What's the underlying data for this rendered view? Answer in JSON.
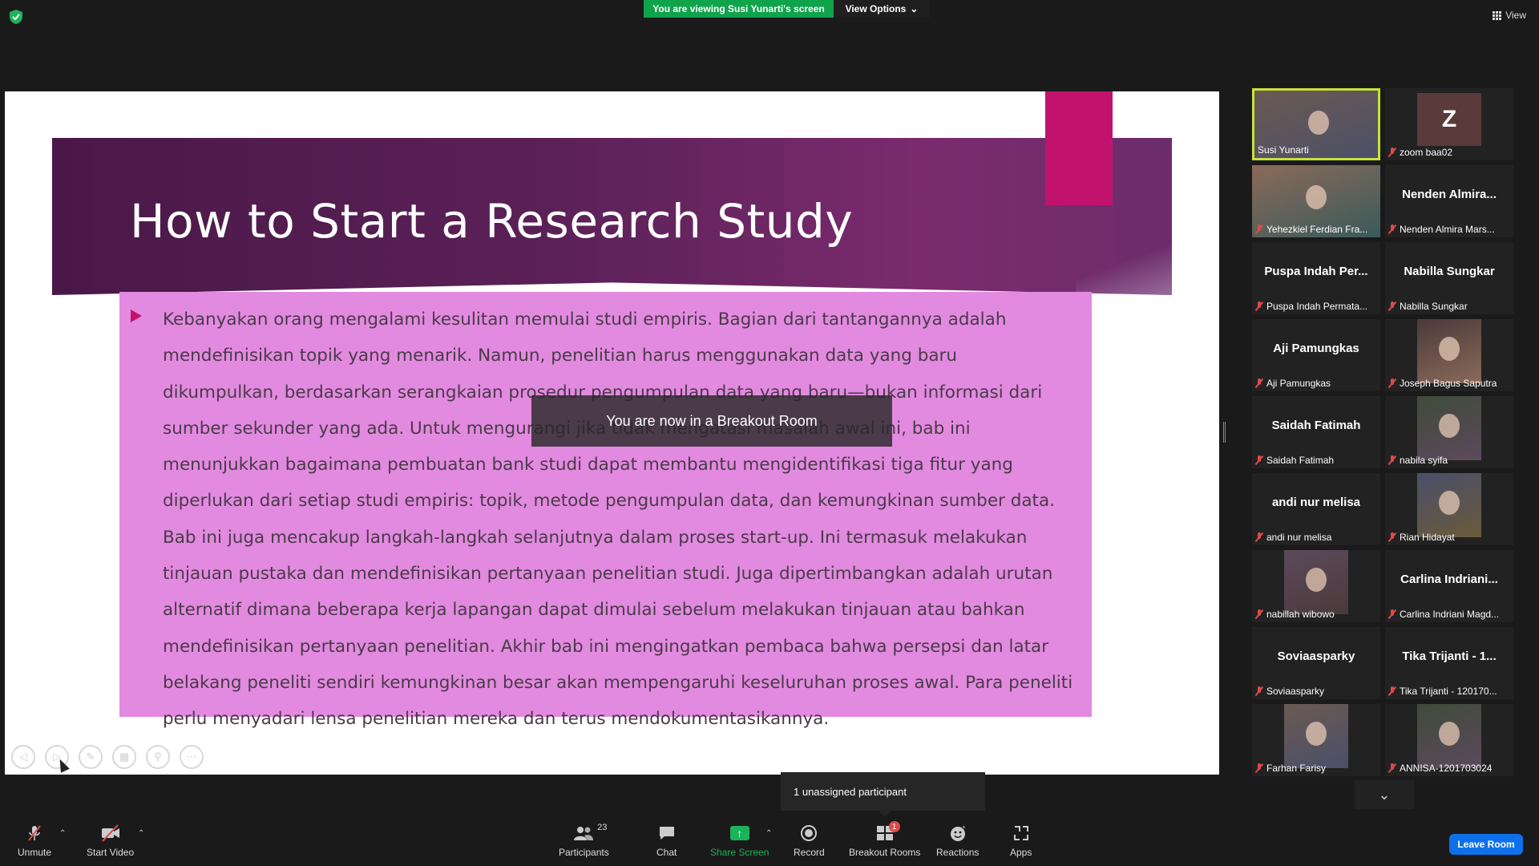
{
  "top": {
    "viewing_banner": "You are viewing Susi Yunarti's screen",
    "view_options": "View Options",
    "view": "View"
  },
  "slide": {
    "title": "How to Start a Research Study",
    "body": "Kebanyakan orang mengalami kesulitan memulai studi empiris. Bagian dari tantangannya adalah mendefinisikan topik yang menarik. Namun, penelitian harus menggunakan data yang baru dikumpulkan, berdasarkan serangkaian prosedur pengumpulan data yang baru—bukan informasi dari sumber sekunder yang ada. Untuk mengurangi jika tidak mengatasi masalah awal ini, bab ini menunjukkan bagaimana pembuatan bank studi dapat membantu mengidentifikasi tiga fitur yang diperlukan dari setiap studi empiris: topik, metode pengumpulan data, dan kemungkinan sumber data. Bab ini juga mencakup langkah-langkah selanjutnya dalam proses start-up. Ini termasuk melakukan tinjauan pustaka dan mendefinisikan pertanyaan penelitian studi. Juga dipertimbangkan adalah urutan alternatif dimana beberapa kerja lapangan dapat dimulai sebelum melakukan tinjauan atau bahkan mendefinisikan pertanyaan penelitian. Akhir bab ini mengingatkan pembaca bahwa persepsi dan latar belakang peneliti sendiri kemungkinan besar akan mempengaruhi keseluruhan proses awal. Para peneliti perlu menyadari lensa penelitian mereka dan terus mendokumentasikannya.",
    "controls": [
      "prev-icon",
      "next-icon",
      "pen-icon",
      "slides-icon",
      "zoom-icon",
      "more-icon"
    ]
  },
  "breakout_toast": "You are now in a Breakout Room",
  "gallery": [
    {
      "big": "",
      "name": "Susi Yunarti",
      "active": true,
      "media": "video"
    },
    {
      "big": "Z",
      "name": "zoom baa02",
      "media": "avatar"
    },
    {
      "big": "",
      "name": "Yehezkiel Ferdian Fra...",
      "media": "video"
    },
    {
      "big": "Nenden Almira...",
      "name": "Nenden Almira Mars..."
    },
    {
      "big": "Puspa Indah Per...",
      "name": "Puspa Indah Permata..."
    },
    {
      "big": "Nabilla Sungkar",
      "name": "Nabilla Sungkar"
    },
    {
      "big": "Aji Pamungkas",
      "name": "Aji Pamungkas"
    },
    {
      "big": "",
      "name": "Joseph Bagus Saputra",
      "media": "photo"
    },
    {
      "big": "Saidah Fatimah",
      "name": "Saidah Fatimah"
    },
    {
      "big": "",
      "name": "nabila syifa",
      "media": "photo"
    },
    {
      "big": "andi nur melisa",
      "name": "andi nur melisa"
    },
    {
      "big": "",
      "name": "Rian Hidayat",
      "media": "photo"
    },
    {
      "big": "",
      "name": "nabillah wibowo",
      "media": "photo"
    },
    {
      "big": "Carlina Indriani...",
      "name": "Carlina Indriani Magd..."
    },
    {
      "big": "Soviaasparky",
      "name": "Soviaasparky"
    },
    {
      "big": "Tika Trijanti - 1...",
      "name": "Tika Trijanti - 120170..."
    },
    {
      "big": "",
      "name": "Farhan Farisy",
      "media": "photo"
    },
    {
      "big": "",
      "name": "ANNISA-1201703024",
      "media": "photo"
    }
  ],
  "unassigned": "1 unassigned participant",
  "toolbar": {
    "unmute": "Unmute",
    "start_video": "Start Video",
    "participants": "Participants",
    "participants_count": "23",
    "chat": "Chat",
    "share_screen": "Share Screen",
    "record": "Record",
    "breakout_rooms": "Breakout Rooms",
    "breakout_badge": "1",
    "reactions": "Reactions",
    "apps": "Apps",
    "leave_room": "Leave Room"
  },
  "colors": {
    "share_green": "#0fa34c",
    "leave_blue": "#0e71eb",
    "slide_pink": "#e28ae0",
    "active_border": "#c6e23c"
  }
}
